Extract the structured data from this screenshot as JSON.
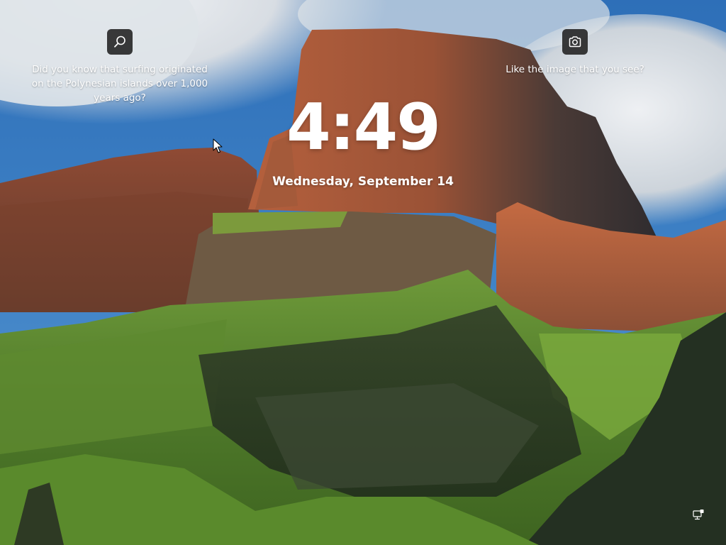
{
  "lock_screen": {
    "fact": {
      "icon": "search-icon",
      "text": "Did you know that surfing originated on the Polynesian islands over 1,000 years ago?"
    },
    "image_info": {
      "icon": "camera-icon",
      "text": "Like the image that you see?"
    },
    "time": "4:49",
    "date": "Wednesday, September 14",
    "status": {
      "icon": "network-icon"
    }
  },
  "colors": {
    "text": "#ffffff",
    "icon_button_bg": "#202020",
    "sky": "#3f7cc0",
    "cliff": "#a35a3c",
    "grass": "#5c8a2e"
  }
}
